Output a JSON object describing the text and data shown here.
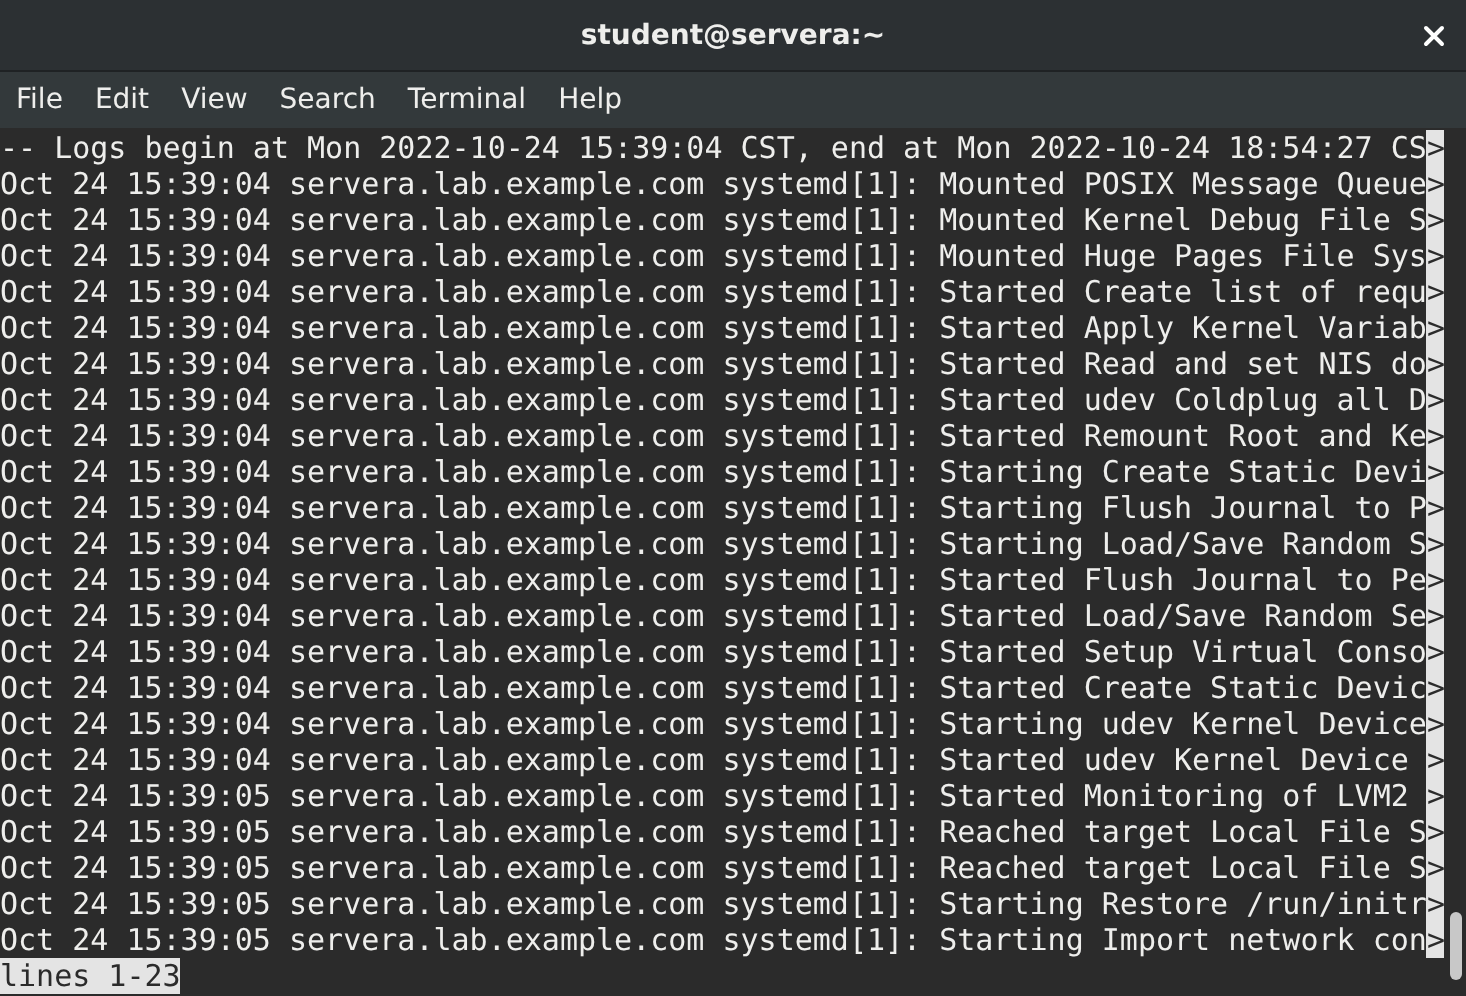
{
  "window": {
    "title": "student@servera:~"
  },
  "menu": [
    "File",
    "Edit",
    "View",
    "Search",
    "Terminal",
    "Help"
  ],
  "terminal": {
    "lines": [
      {
        "text": "-- Logs begin at Mon 2022-10-24 15:39:04 CST, end at Mon 2022-10-24 18:54:27 CS",
        "marker": ">"
      },
      {
        "text": "Oct 24 15:39:04 servera.lab.example.com systemd[1]: Mounted POSIX Message Queue",
        "marker": ">"
      },
      {
        "text": "Oct 24 15:39:04 servera.lab.example.com systemd[1]: Mounted Kernel Debug File S",
        "marker": ">"
      },
      {
        "text": "Oct 24 15:39:04 servera.lab.example.com systemd[1]: Mounted Huge Pages File Sys",
        "marker": ">"
      },
      {
        "text": "Oct 24 15:39:04 servera.lab.example.com systemd[1]: Started Create list of requ",
        "marker": ">"
      },
      {
        "text": "Oct 24 15:39:04 servera.lab.example.com systemd[1]: Started Apply Kernel Variab",
        "marker": ">"
      },
      {
        "text": "Oct 24 15:39:04 servera.lab.example.com systemd[1]: Started Read and set NIS do",
        "marker": ">"
      },
      {
        "text": "Oct 24 15:39:04 servera.lab.example.com systemd[1]: Started udev Coldplug all D",
        "marker": ">"
      },
      {
        "text": "Oct 24 15:39:04 servera.lab.example.com systemd[1]: Started Remount Root and Ke",
        "marker": ">"
      },
      {
        "text": "Oct 24 15:39:04 servera.lab.example.com systemd[1]: Starting Create Static Devi",
        "marker": ">"
      },
      {
        "text": "Oct 24 15:39:04 servera.lab.example.com systemd[1]: Starting Flush Journal to P",
        "marker": ">"
      },
      {
        "text": "Oct 24 15:39:04 servera.lab.example.com systemd[1]: Starting Load/Save Random S",
        "marker": ">"
      },
      {
        "text": "Oct 24 15:39:04 servera.lab.example.com systemd[1]: Started Flush Journal to Pe",
        "marker": ">"
      },
      {
        "text": "Oct 24 15:39:04 servera.lab.example.com systemd[1]: Started Load/Save Random Se",
        "marker": ">"
      },
      {
        "text": "Oct 24 15:39:04 servera.lab.example.com systemd[1]: Started Setup Virtual Conso",
        "marker": ">"
      },
      {
        "text": "Oct 24 15:39:04 servera.lab.example.com systemd[1]: Started Create Static Devic",
        "marker": ">"
      },
      {
        "text": "Oct 24 15:39:04 servera.lab.example.com systemd[1]: Starting udev Kernel Device",
        "marker": ">"
      },
      {
        "text": "Oct 24 15:39:04 servera.lab.example.com systemd[1]: Started udev Kernel Device ",
        "marker": ">"
      },
      {
        "text": "Oct 24 15:39:05 servera.lab.example.com systemd[1]: Started Monitoring of LVM2 ",
        "marker": ">"
      },
      {
        "text": "Oct 24 15:39:05 servera.lab.example.com systemd[1]: Reached target Local File S",
        "marker": ">"
      },
      {
        "text": "Oct 24 15:39:05 servera.lab.example.com systemd[1]: Reached target Local File S",
        "marker": ">"
      },
      {
        "text": "Oct 24 15:39:05 servera.lab.example.com systemd[1]: Starting Restore /run/initr",
        "marker": ">"
      },
      {
        "text": "Oct 24 15:39:05 servera.lab.example.com systemd[1]: Starting Import network con",
        "marker": ">"
      }
    ],
    "pager_status": "lines 1-23"
  }
}
